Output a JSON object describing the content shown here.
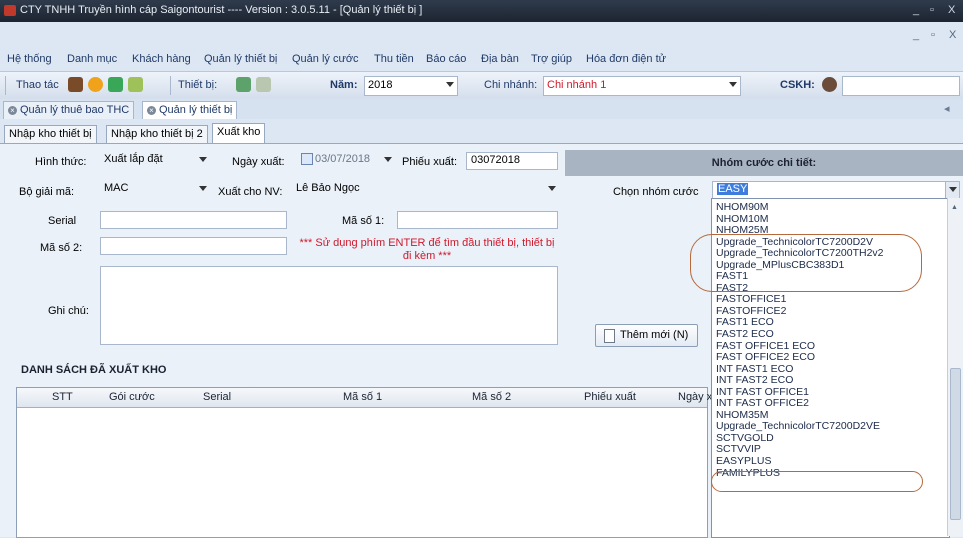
{
  "window": {
    "title": "CTY TNHH Truyền hình cáp Saigontourist  ---- Version : 3.0.5.11 - [Quản lý thiết bị ]",
    "min_glyph": "_",
    "restore_glyph": "▫",
    "close_glyph": "X"
  },
  "menu": [
    "Hệ thống",
    "Danh mục",
    "Khách hàng",
    "Quản lý thiết bị",
    "Quản lý cước",
    "Thu tiền",
    "Báo cáo",
    "Địa bàn",
    "Trợ giúp",
    "Hóa đơn điện tử"
  ],
  "toolbar": {
    "thao_tac": "Thao tác",
    "thiet_bi": "Thiết bị:",
    "nam_label": "Năm:",
    "nam_value": "2018",
    "chi_nhanh_label": "Chi nhánh:",
    "chi_nhanh_value": "Chi nhánh 1",
    "cskh_label": "CSKH:"
  },
  "doc_tabs": [
    "Quản lý thuê bao THC",
    "Quản lý thiết bị"
  ],
  "inner_tabs": [
    "Nhập kho thiết bị",
    "Nhập kho thiết bị 2",
    "Xuất kho"
  ],
  "form": {
    "hinh_thuc_label": "Hình thức:",
    "hinh_thuc_value": "Xuất lắp đặt",
    "ngay_xuat_label": "Ngày xuất:",
    "ngay_xuat_value": "03/07/2018",
    "phieu_xuat_label": "Phiếu xuất:",
    "phieu_xuat_value": "03072018",
    "bo_giai_ma_label": "Bộ giải mã:",
    "bo_giai_ma_value": "MAC",
    "xuat_cho_nv_label": "Xuất cho NV:",
    "xuat_cho_nv_value": "Lê Bảo Ngọc",
    "serial_label": "Serial",
    "ma_so_1_label": "Mã số 1:",
    "ma_so_2_label": "Mã số 2:",
    "warning": "*** Sử dụng phím ENTER để tìm đầu thiết bị, thiết bị đi kèm ***",
    "ghi_chu_label": "Ghi chú:",
    "right_header": "Nhóm cước chi tiết:",
    "chon_nhom_cuoc_label": "Chọn nhóm cước",
    "chon_nhom_cuoc_value": "EASY",
    "them_moi_button": "Thêm mới (N)"
  },
  "list": {
    "title": "DANH SÁCH ĐÃ XUẤT KHO",
    "columns": [
      "STT",
      "Gói cước",
      "Serial",
      "Mã số 1",
      "Mã số 2",
      "Phiếu xuất",
      "Ngày x"
    ]
  },
  "dropdown_items": [
    "NHOM90M",
    "NHOM10M",
    "NHOM25M",
    "Upgrade_TechnicolorTC7200D2V",
    "Upgrade_TechnicolorTC7200TH2v2",
    "Upgrade_MPlusCBC383D1",
    "FAST1",
    "FAST2",
    "FASTOFFICE1",
    "FASTOFFICE2",
    "FAST1 ECO",
    "FAST2 ECO",
    "FAST OFFICE1 ECO",
    "FAST OFFICE2 ECO",
    "INT FAST1 ECO",
    "INT FAST2 ECO",
    "INT FAST OFFICE1",
    "INT FAST OFFICE2",
    "NHOM35M",
    "Upgrade_TechnicolorTC7200D2VE",
    "SCTVGOLD",
    "SCTVVIP",
    "EASYPLUS",
    "FAMILYPLUS"
  ],
  "colors": {
    "highlight_oval": "#b5693d",
    "warning_text": "#d0182b",
    "branch_value": "#d0182b"
  }
}
